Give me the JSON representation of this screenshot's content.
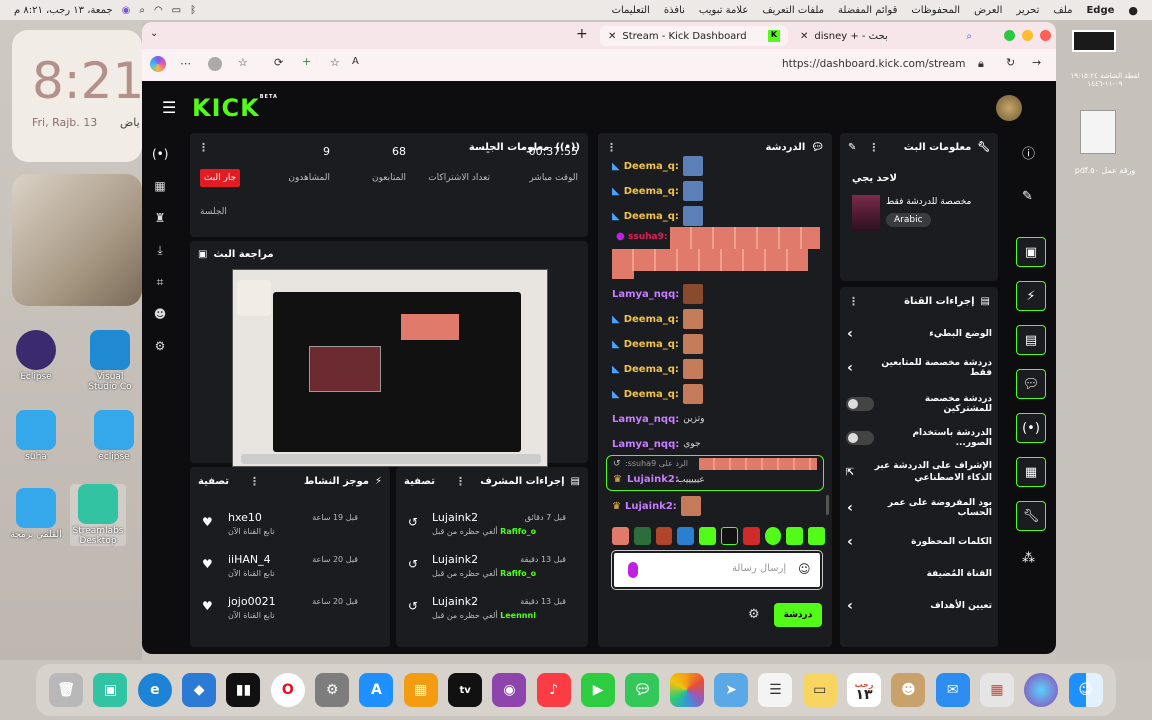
{
  "menubar": {
    "app": "Edge",
    "items": [
      "ملف",
      "تحرير",
      "العرض",
      "المحفوظات",
      "قوائم المفضلة",
      "ملفات التعريف",
      "علامة تبويب",
      "نافذة",
      "التعليمات"
    ],
    "clock": "جمعة، ١٣ رجب، ٨:٢١ م"
  },
  "widget": {
    "time": "8:21",
    "date": "Fri, Rajb. 13",
    "date_ar": "ياض"
  },
  "desktop": {
    "icons": [
      "Eclipse",
      "Visual Studio Co",
      "suha",
      "eclipse",
      "القلمي برمجة",
      "Streamlabs Desktop"
    ],
    "right_icons": [
      "لقطة الشاشة ١٩:١٥:٢٤ ٠٩-١١-١٤٤٦",
      "ملف ١٩:١٥:٥٩ ١٦:٠٥ عمل",
      "ورقة عمل ٥٠.pdf"
    ]
  },
  "browser": {
    "tabs": [
      {
        "label": "Stream - Kick Dashboard"
      },
      {
        "label": "disney + - بحث"
      }
    ],
    "url": "https://dashboard.kick.com/stream"
  },
  "kick": {
    "logo": "KICK",
    "beta": "BETA"
  },
  "session": {
    "title": "معلومات الجلسة",
    "live_badge": "جار البث",
    "stats": [
      {
        "value": "00:37:55",
        "label": "الوقت مباشر"
      },
      {
        "value": "-",
        "label": "تعداد الاشتراكات"
      },
      {
        "value": "68",
        "label": "المتابعون"
      },
      {
        "value": "9",
        "label": "المشاهدون"
      }
    ],
    "session_label": "الجلسة"
  },
  "review": {
    "title": "مراجعة البث"
  },
  "activity": {
    "title": "موجز النشاط",
    "filter": "تصفية",
    "items": [
      {
        "name": "hxe10",
        "sub": "تابع القناة الآن",
        "time": "قبل 19 ساعة"
      },
      {
        "name": "iiHAN_4",
        "sub": "تابع القناة الآن",
        "time": "قبل 20 ساعة"
      },
      {
        "name": "jojo0021",
        "sub": "تابع القناة الآن",
        "time": "قبل 20 ساعة"
      }
    ]
  },
  "mod": {
    "title": "إجراءات المشرف",
    "filter": "تصفية",
    "items": [
      {
        "name": "Lujaink2",
        "target": "Rafifo_o",
        "sub": "ألغي حظره من قبل",
        "time": "قبل 7 دقائق"
      },
      {
        "name": "Lujaink2",
        "target": "Rafifo_o",
        "sub": "ألغي حظره من قبل",
        "time": "قبل 13 دقيقة"
      },
      {
        "name": "Lujaink2",
        "target": "Leennnl",
        "sub": "ألغي حظره من قبل",
        "time": "قبل 13 دقيقة"
      }
    ]
  },
  "chat": {
    "title": "الدردشة",
    "messages": [
      {
        "user": "Deema_q:",
        "color": "#f0c24a",
        "text": ""
      },
      {
        "user": "Deema_q:",
        "color": "#f0c24a",
        "text": ""
      },
      {
        "user": "Deema_q:",
        "color": "#f0c24a",
        "text": ""
      },
      {
        "user": "ssuha9:",
        "color": "#e0205a",
        "text": ""
      },
      {
        "user": "Lamya_nqq:",
        "color": "#c77dff",
        "text": ""
      },
      {
        "user": "Deema_q:",
        "color": "#f0c24a",
        "text": ""
      },
      {
        "user": "Deema_q:",
        "color": "#f0c24a",
        "text": ""
      },
      {
        "user": "Deema_q:",
        "color": "#f0c24a",
        "text": ""
      },
      {
        "user": "Deema_q:",
        "color": "#f0c24a",
        "text": ""
      },
      {
        "user": "Lamya_nqq:",
        "color": "#c77dff",
        "text": "وتزين"
      },
      {
        "user": "Lamya_nqq:",
        "color": "#c77dff",
        "text": "جوي"
      }
    ],
    "reply_to": "الرد على ssuha9:",
    "reply_user": "Lujaink2:",
    "reply_text": "عيييييب",
    "last_user": "Lujaink2:",
    "placeholder": "إرسال رسالة",
    "send": "دردشة"
  },
  "stream_info": {
    "title": "معلومات البث",
    "stream_title": "لاحد يجي",
    "category": "مخصصة للدردشة فقط",
    "language": "Arabic"
  },
  "channel": {
    "title": "إجراءات القناة",
    "settings": [
      {
        "label": "الوضع البطيء",
        "type": "chevron"
      },
      {
        "label": "دردشة مخصصة للمتابعين فقط",
        "type": "chevron"
      },
      {
        "label": "دردشة مخصصة للمشتركين",
        "type": "toggle"
      },
      {
        "label": "الدردشة باستخدام الصور...",
        "type": "toggle"
      },
      {
        "label": "الإشراف على الدردشة عبر الذكاء الاصطناعي",
        "type": "link"
      },
      {
        "label": "بود المفروضة على عمر الحساب",
        "type": "chevron"
      },
      {
        "label": "الكلمات المحظورة",
        "type": "chevron"
      },
      {
        "label": "القناة المُضيفة",
        "type": "none"
      },
      {
        "label": "تعيين الأهداف",
        "type": "chevron"
      }
    ]
  },
  "dock": {
    "calendar_month": "رجب",
    "calendar_day": "١٣"
  },
  "colors": {
    "kick_green": "#53fc18",
    "live_red": "#e31b23",
    "bg": "#0d0d0f",
    "panel": "#1b1c1f"
  }
}
